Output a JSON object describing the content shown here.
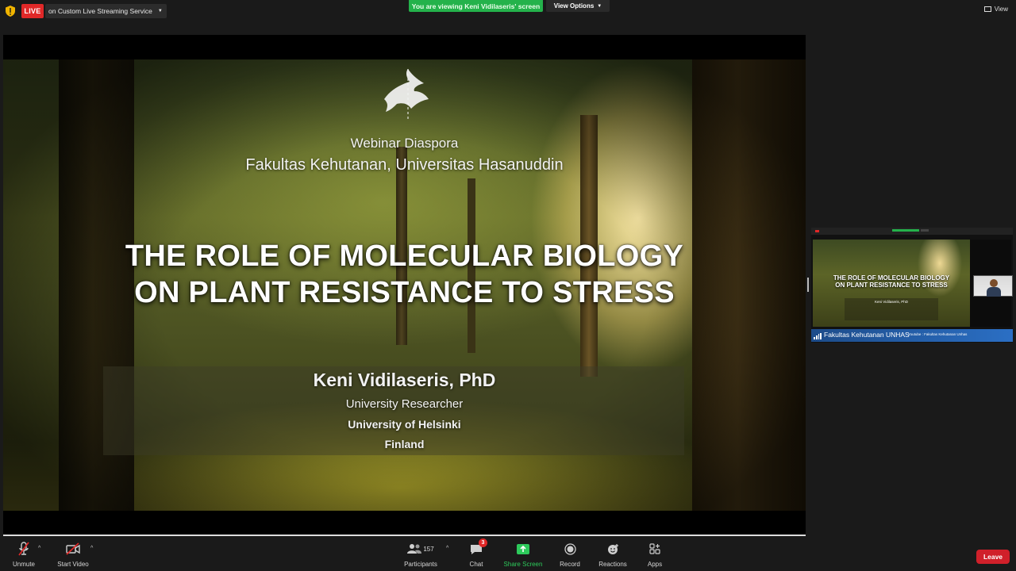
{
  "topbar": {
    "live_label": "LIVE",
    "live_service": "on Custom Live Streaming Service",
    "viewing_banner": "You are viewing Keni Vidilaseris' screen",
    "view_options_label": "View Options",
    "view_label": "View",
    "colors": {
      "live": "#e02828",
      "banner": "#24b24b"
    }
  },
  "slide": {
    "subtitle_1": "Webinar Diaspora",
    "subtitle_2": "Fakultas Kehutanan, Universitas Hasanuddin",
    "title_line_1": "THE ROLE OF MOLECULAR BIOLOGY",
    "title_line_2": "ON PLANT RESISTANCE TO STRESS",
    "speaker_name": "Keni Vidilaseris, PhD",
    "speaker_role": "University Researcher",
    "speaker_org": "University of Helsinki",
    "speaker_country": "Finland",
    "logo_icon": "university-of-helsinki-logo"
  },
  "thumbnail": {
    "participant_name": "Fakultas Kehutanan UNHAS",
    "title_line_1": "THE ROLE OF MOLECULAR BIOLOGY",
    "title_line_2": "ON PLANT RESISTANCE TO STRESS",
    "speaker_name": "Keni Vidilaseris, PhD",
    "youtube_note": "Youtube : Fakultas Kehutanan Unhas"
  },
  "toolbar": {
    "unmute": "Unmute",
    "start_video": "Start Video",
    "participants": "Participants",
    "participants_count": "157",
    "chat": "Chat",
    "chat_badge": "3",
    "share_screen": "Share Screen",
    "record": "Record",
    "reactions": "Reactions",
    "apps": "Apps",
    "leave": "Leave",
    "colors": {
      "share": "#2dca5b",
      "leave": "#d0202a"
    }
  }
}
